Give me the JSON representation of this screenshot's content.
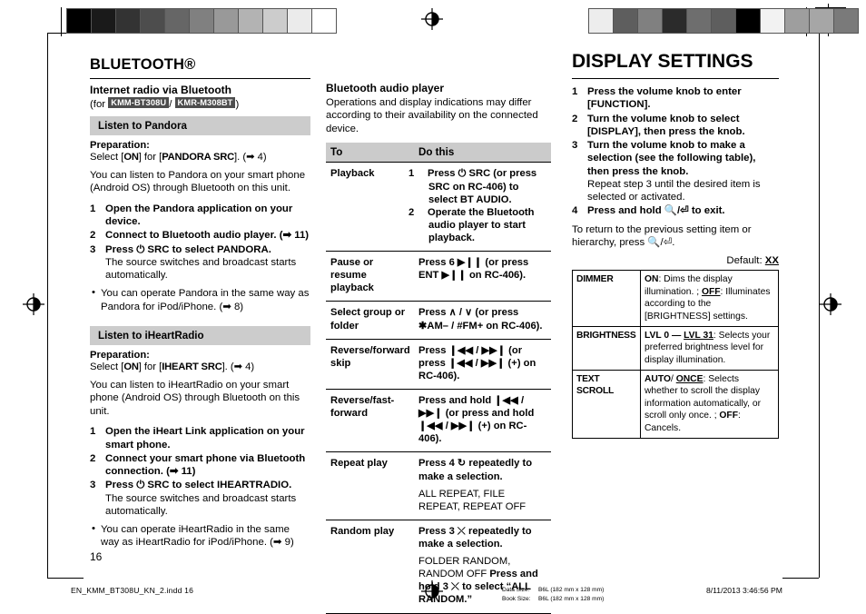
{
  "page": {
    "number": "16",
    "footer_file": "EN_KMM_BT308U_KN_2.indd   16",
    "footer_timestamp": "8/11/2013   3:46:56 PM",
    "data_size_label": "Data Size:",
    "data_size_value": "B6L (182 mm x 128 mm)",
    "book_size_label": "Book Size:",
    "book_size_value": "B6L (182 mm x 128 mm)"
  },
  "marks": {
    "wedge_left": [
      "#000000",
      "#1a1a1a",
      "#333333",
      "#4d4d4d",
      "#666666",
      "#808080",
      "#999999",
      "#b3b3b3",
      "#cccccc",
      "#ebebeb",
      "#ffffff"
    ],
    "wedge_right": [
      "#ededed",
      "#5e5e5e",
      "#808080",
      "#2b2b2b",
      "#6e6e6e",
      "#5e5e5e",
      "#000000",
      "#f2f2f2",
      "#9e9e9e",
      "#a6a6a6",
      "#7a7a7a"
    ]
  },
  "col1": {
    "chapter": "BLUETOOTH®",
    "section_title": "Internet radio via Bluetooth",
    "for_prefix": "(for ",
    "badge1": "KMM-BT308U",
    "for_slash": "/ ",
    "badge2": "KMR-M308BT",
    "for_suffix": ")",
    "pandora": {
      "band": "Listen to Pandora",
      "prep_label": "Preparation:",
      "prep_text_a": "Select [",
      "prep_on": "ON",
      "prep_text_b": "] for [",
      "prep_src": "PANDORA SRC",
      "prep_text_c": "]. (",
      "prep_arrow": "➡",
      "prep_page": " 4)",
      "intro": "You can listen to Pandora on your smart phone (Android OS) through Bluetooth on this unit.",
      "steps": [
        {
          "n": "1",
          "text": "Open the Pandora application on your device.",
          "sub": ""
        },
        {
          "n": "2",
          "text": "Connect to Bluetooth audio player. (➡ 11)",
          "sub": ""
        },
        {
          "n": "3",
          "text": "Press ⏻ SRC to select PANDORA.",
          "sub": "The source switches and broadcast starts automatically."
        }
      ],
      "bullet": "You can operate Pandora in the same way as Pandora for iPod/iPhone. (➡ 8)"
    },
    "iheart": {
      "band": "Listen to iHeartRadio",
      "prep_label": "Preparation:",
      "prep_text_a": "Select [",
      "prep_on": "ON",
      "prep_text_b": "] for [",
      "prep_src": "IHEART SRC",
      "prep_text_c": "]. (",
      "prep_arrow": "➡",
      "prep_page": " 4)",
      "intro": "You can listen to iHeartRadio on your smart phone (Android OS) through Bluetooth on this unit.",
      "steps": [
        {
          "n": "1",
          "text": "Open the iHeart Link application on your smart phone.",
          "sub": ""
        },
        {
          "n": "2",
          "text": "Connect your smart phone via Bluetooth connection. (➡ 11)",
          "sub": ""
        },
        {
          "n": "3",
          "text": "Press ⏻ SRC to select IHEARTRADIO.",
          "sub": "The source switches and broadcast starts automatically."
        }
      ],
      "bullet": "You can operate iHeartRadio in the same way as iHeartRadio for iPod/iPhone. (➡ 9)"
    }
  },
  "col2": {
    "section_title": "Bluetooth audio player",
    "intro": "Operations and display indications may differ according to their availability on the connected device.",
    "table": {
      "headers": [
        "To",
        "Do this"
      ],
      "rows": [
        {
          "label": "Playback",
          "step1_n": "1",
          "step1": "Press ⏻ SRC (or press SRC on RC-406) to select BT AUDIO.",
          "step2_n": "2",
          "step2": "Operate the Bluetooth audio player to start playback."
        },
        {
          "label": "Pause or resume playback",
          "action": "Press 6 ▶❙❙ (or press ENT ▶❙❙ on RC-406)."
        },
        {
          "label": "Select group or folder",
          "action": "Press ∧ / ∨ (or press ✱AM– / #FM+ on RC-406)."
        },
        {
          "label": "Reverse/forward skip",
          "action": "Press ❙◀◀ / ▶▶❙ (or press ❙◀◀ / ▶▶❙ (+) on RC-406)."
        },
        {
          "label": "Reverse/fast-forward",
          "action": "Press and hold ❙◀◀ / ▶▶❙ (or press and hold ❙◀◀ / ▶▶❙ (+) on RC-406)."
        },
        {
          "label": "Repeat play",
          "action": "Press 4 ↻ repeatedly to make a selection.",
          "note": "ALL REPEAT, FILE REPEAT, REPEAT OFF"
        },
        {
          "label": "Random play",
          "action": "Press 3 ⤬ repeatedly to make a selection.",
          "note": "FOLDER RANDOM, RANDOM OFF",
          "note_bold": "Press and hold 3 ⤬ to select “ALL RANDOM.”"
        }
      ]
    }
  },
  "col3": {
    "chapter": "DISPLAY SETTINGS",
    "steps": [
      {
        "n": "1",
        "text": "Press the volume knob to enter [FUNCTION].",
        "sub": ""
      },
      {
        "n": "2",
        "text": "Turn the volume knob to select [DISPLAY], then press the knob.",
        "sub": ""
      },
      {
        "n": "3",
        "text": "Turn the volume knob to make a selection (see the following table), then press the knob.",
        "sub": "Repeat step 3 until the desired item is selected or activated."
      },
      {
        "n": "4",
        "text": "Press and hold 🔍/⏎ to exit.",
        "sub": ""
      }
    ],
    "return_text": "To return to the previous setting item or hierarchy, press 🔍/⏎.",
    "default_label": "Default: ",
    "default_value": "XX",
    "table": [
      {
        "key": "DIMMER",
        "parts": [
          {
            "t": "ON",
            "s": "b"
          },
          {
            "t": ": Dims the display illumination. ; ",
            "s": "n"
          },
          {
            "t": "OFF",
            "s": "u"
          },
          {
            "t": ": Illuminates according to the [BRIGHTNESS] settings.",
            "s": "n"
          }
        ]
      },
      {
        "key": "BRIGHTNESS",
        "parts": [
          {
            "t": "LVL 0 — ",
            "s": "b"
          },
          {
            "t": "LVL 31",
            "s": "u"
          },
          {
            "t": ": Selects your preferred brightness level for display illumination.",
            "s": "n"
          }
        ]
      },
      {
        "key": "TEXT SCROLL",
        "parts": [
          {
            "t": "AUTO",
            "s": "b"
          },
          {
            "t": "/ ",
            "s": "n"
          },
          {
            "t": "ONCE",
            "s": "u"
          },
          {
            "t": ": Selects whether to scroll the display information automatically, or scroll only once. ; ",
            "s": "n"
          },
          {
            "t": "OFF",
            "s": "b"
          },
          {
            "t": ": Cancels.",
            "s": "n"
          }
        ]
      }
    ]
  }
}
